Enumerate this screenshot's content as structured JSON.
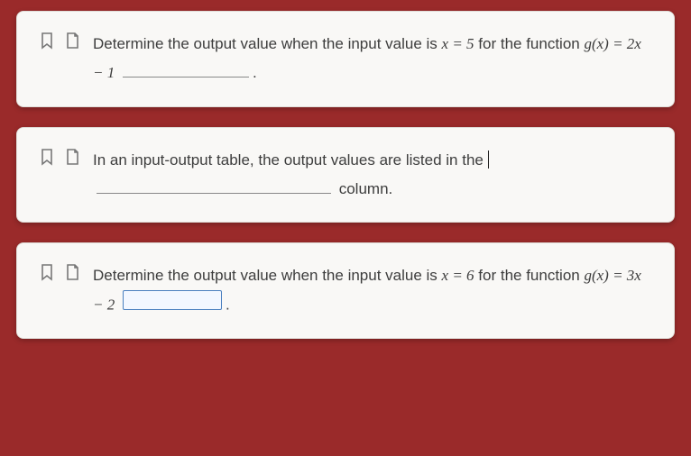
{
  "questions": [
    {
      "text_a": "Determine the output value when the input value is ",
      "math_a": "x = 5",
      "text_b": " for the function ",
      "math_b": "g(x) = 2x − 1",
      "blank_style": "plain",
      "tail": "."
    },
    {
      "text_a": "In an input-output table, the output values are listed in the ",
      "tail": " column.",
      "blank_style": "wide"
    },
    {
      "text_a": "Determine the output value when the input value is ",
      "math_a": "x = 6",
      "text_b": " for the function ",
      "math_b": "g(x) = 3x − 2",
      "blank_style": "active",
      "tail": "."
    }
  ],
  "icons": {
    "bookmark": "bookmark-icon",
    "note": "note-icon"
  }
}
